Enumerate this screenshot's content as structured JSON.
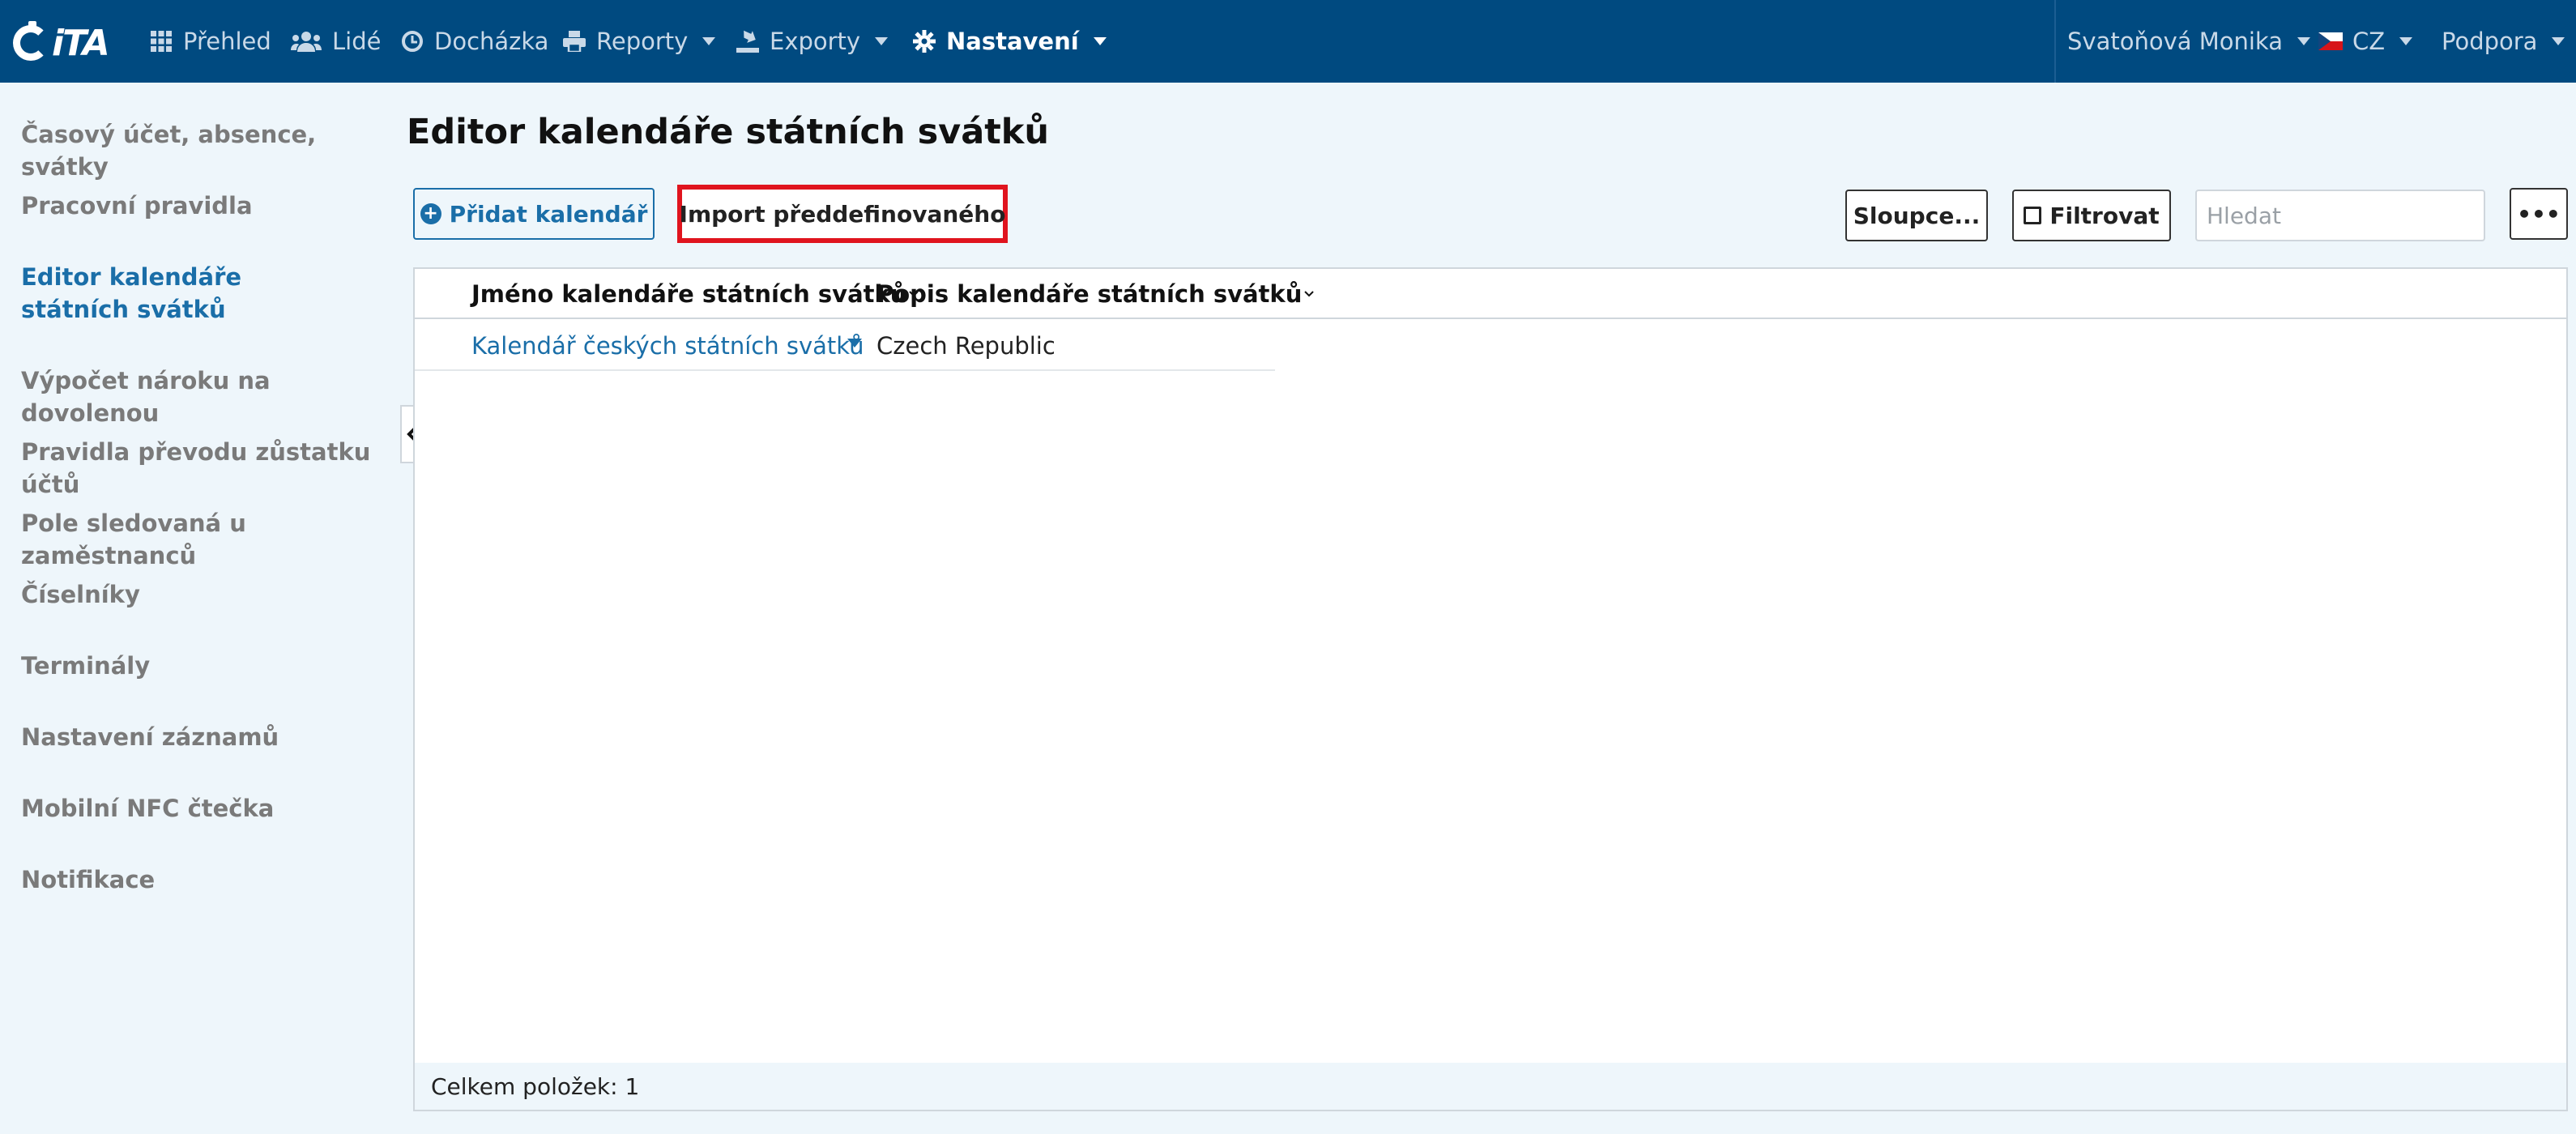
{
  "app": {
    "logo_text": "iTA"
  },
  "navbar": {
    "items": [
      {
        "label": "Přehled",
        "icon": "grid-icon"
      },
      {
        "label": "Lidé",
        "icon": "users-icon"
      },
      {
        "label": "Docházka",
        "icon": "clock-icon"
      },
      {
        "label": "Reporty",
        "icon": "printer-icon"
      },
      {
        "label": "Exporty",
        "icon": "export-icon"
      },
      {
        "label": "Nastavení",
        "icon": "gear-icon",
        "active": true
      }
    ],
    "user": "Svatoňová Monika",
    "language": "CZ",
    "support": "Podpora"
  },
  "sidebar": {
    "items": [
      {
        "label": "Časový účet, absence, svátky"
      },
      {
        "label": "Pracovní pravidla"
      },
      {
        "label": "Editor kalendáře státních svátků",
        "active": true
      },
      {
        "label": "Výpočet nároku na dovolenou"
      },
      {
        "label": "Pravidla převodu zůstatku účtů"
      },
      {
        "label": "Pole sledovaná u zaměstnanců"
      },
      {
        "label": "Číselníky"
      },
      {
        "label": "Terminály"
      },
      {
        "label": "Nastavení záznamů"
      },
      {
        "label": "Mobilní NFC čtečka"
      },
      {
        "label": "Notifikace"
      }
    ]
  },
  "main": {
    "title": "Editor kalendáře státních svátků",
    "toolbar": {
      "add_label": "Přidat kalendář",
      "import_label": "Import předdefinovaného",
      "columns_label": "Sloupce...",
      "filter_label": "Filtrovat",
      "search_placeholder": "Hledat",
      "search_value": "",
      "more_label": "•••"
    },
    "table": {
      "columns": [
        "Jméno kalendáře státních svátků",
        "Popis kalendáře státních svátků"
      ],
      "rows": [
        [
          "Kalendář českých státních svátků",
          "Czech Republic"
        ]
      ],
      "footer": "Celkem položek: 1"
    }
  },
  "colors": {
    "navbar": "#004a80",
    "accent": "#1a6ea8",
    "highlight": "#e0141e",
    "background": "#eef6fb"
  }
}
